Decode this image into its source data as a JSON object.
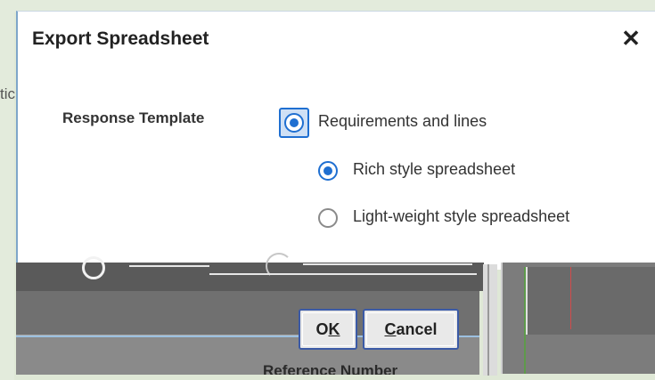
{
  "dialog": {
    "title": "Export Spreadsheet",
    "close_symbol": "✕"
  },
  "background_fragment": "tic",
  "field": {
    "label": "Response Template",
    "options": [
      {
        "label": "Requirements and lines",
        "selected": true,
        "focused": true
      },
      {
        "label": "Rich style spreadsheet",
        "selected": true
      },
      {
        "label": "Light-weight style spreadsheet",
        "selected": false
      }
    ]
  },
  "buttons": {
    "ok_prefix": "O",
    "ok_accel": "K",
    "cancel_accel": "C",
    "cancel_rest": "ancel"
  },
  "background_text": "Reference Number",
  "colors": {
    "accent": "#1f6fd1",
    "button_border": "#3b5aa6"
  }
}
